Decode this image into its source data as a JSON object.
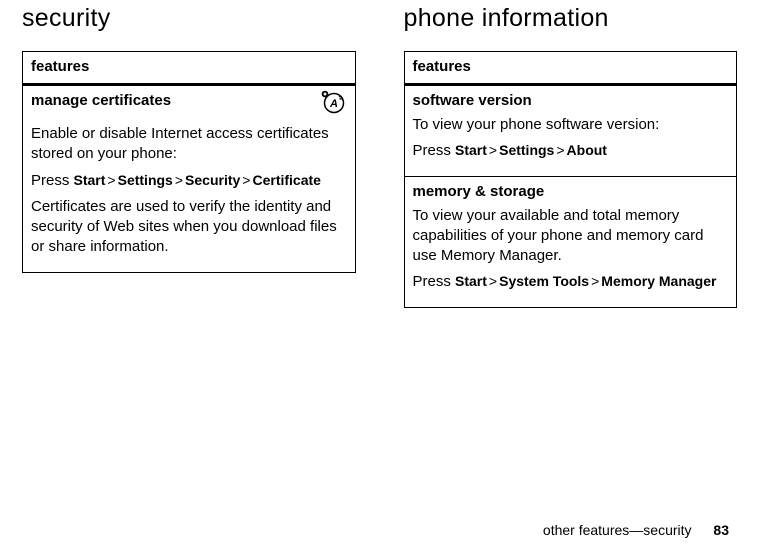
{
  "left": {
    "heading": "security",
    "table_header": "features",
    "rows": [
      {
        "title": "manage certificates",
        "icon": "operator-icon",
        "body1": "Enable or disable Internet access certificates stored on your phone:",
        "press_prefix": "Press ",
        "press_path": [
          "Start",
          "Settings",
          "Security",
          "Certificate"
        ],
        "body2": "Certificates are used to verify the identity and security of Web sites when you download files or share information."
      }
    ]
  },
  "right": {
    "heading": "phone information",
    "table_header": "features",
    "rows": [
      {
        "title": "software version",
        "body1": "To view your phone software version:",
        "press_prefix": "Press ",
        "press_path": [
          "Start",
          "Settings",
          "About"
        ]
      },
      {
        "title": "memory & storage",
        "body1": "To view your available and total memory capabilities of your phone and memory card use Memory Manager.",
        "press_prefix": "Press ",
        "press_path": [
          "Start",
          "System Tools",
          "Memory Manager"
        ]
      }
    ]
  },
  "footer": {
    "breadcrumb": "other features—security",
    "page": "83"
  },
  "sep": ">"
}
